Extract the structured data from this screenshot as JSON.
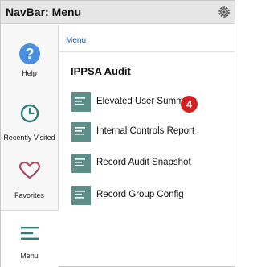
{
  "header": {
    "title": "NavBar: Menu",
    "gear_icon": "gear-icon"
  },
  "sidebar": {
    "items": [
      {
        "label": "Help",
        "icon": "help-icon"
      },
      {
        "label": "Recently Visited",
        "icon": "clock-icon"
      },
      {
        "label": "Favorites",
        "icon": "heart-icon"
      },
      {
        "label": "Menu",
        "icon": "menu-icon"
      }
    ]
  },
  "main": {
    "breadcrumb": "Menu",
    "section_title": "IPPSA Audit",
    "items": [
      {
        "label": "Elevated User Summary"
      },
      {
        "label": "Internal Controls Report"
      },
      {
        "label": "Record Audit Snapshot"
      },
      {
        "label": "Record Group Config"
      }
    ]
  },
  "badge": {
    "value": "4",
    "color": "#d21f1f"
  },
  "colors": {
    "accent": "#5e8e88",
    "help_blue": "#4a8fe0",
    "teal": "#2e7d78",
    "heart": "#a84c66",
    "link": "#1f5aa8"
  }
}
